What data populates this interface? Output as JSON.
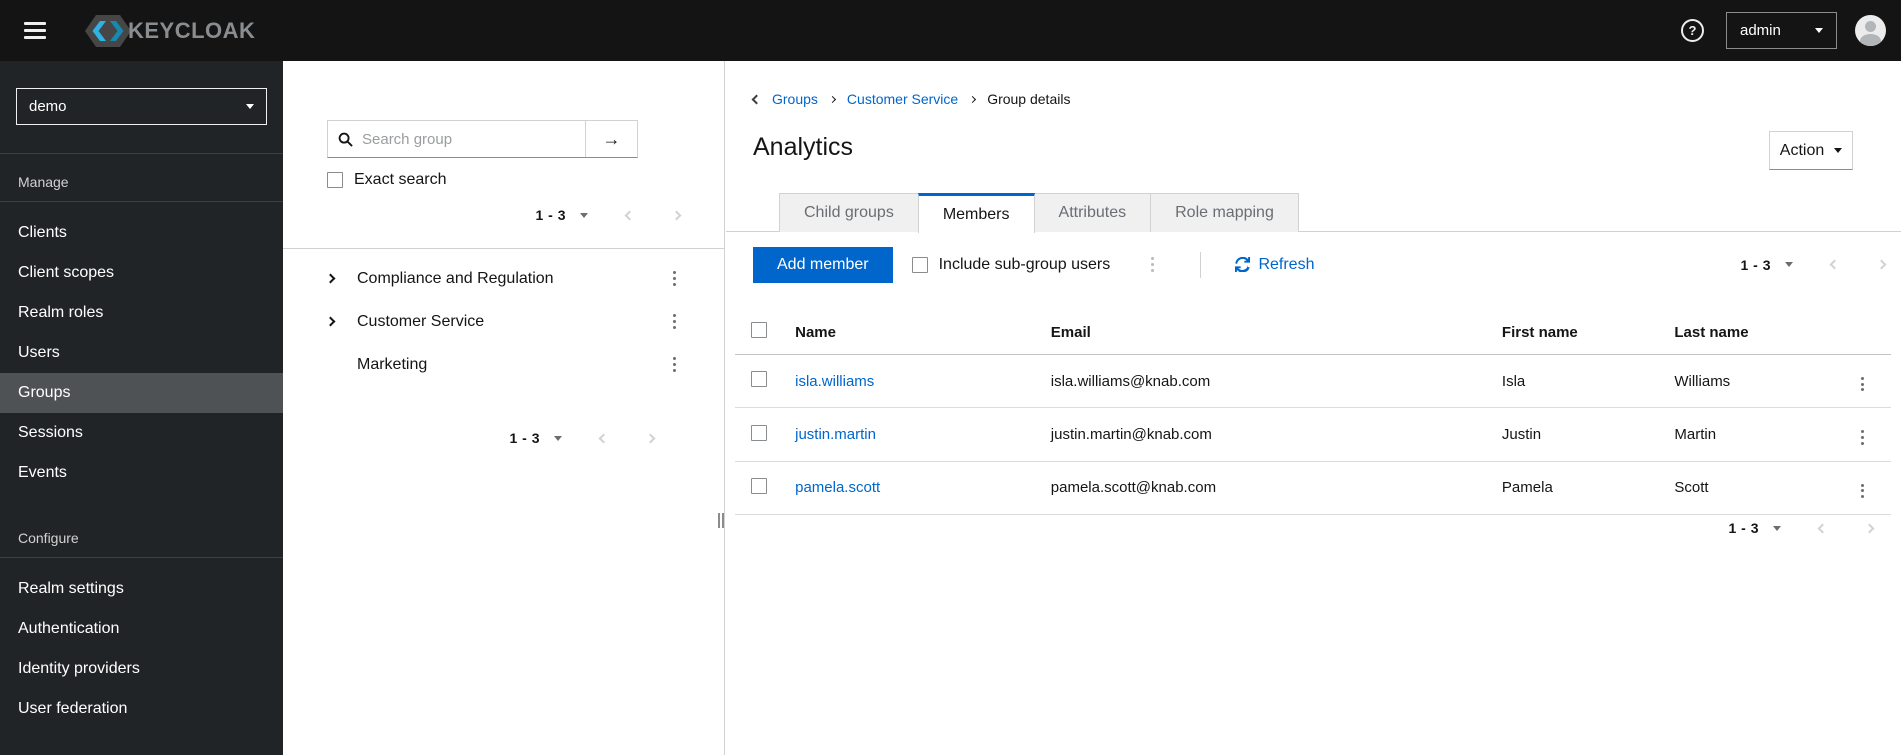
{
  "topbar": {
    "brand": "KEYCLOAK",
    "user": "admin"
  },
  "sidebar": {
    "realm": "demo",
    "sections": [
      {
        "label": "Manage",
        "items": [
          {
            "label": "Clients"
          },
          {
            "label": "Client scopes"
          },
          {
            "label": "Realm roles"
          },
          {
            "label": "Users"
          },
          {
            "label": "Groups",
            "selected": true
          },
          {
            "label": "Sessions"
          },
          {
            "label": "Events"
          }
        ]
      },
      {
        "label": "Configure",
        "items": [
          {
            "label": "Realm settings"
          },
          {
            "label": "Authentication"
          },
          {
            "label": "Identity providers"
          },
          {
            "label": "User federation"
          }
        ]
      }
    ]
  },
  "tree_panel": {
    "search_placeholder": "Search group",
    "exact_search": "Exact search",
    "pagination_top": "1 - 3",
    "pagination_bottom": "1 - 3",
    "groups": [
      {
        "name": "Compliance and Regulation",
        "expandable": true
      },
      {
        "name": "Customer Service",
        "expandable": true
      },
      {
        "name": "Marketing",
        "expandable": false
      }
    ]
  },
  "main": {
    "breadcrumb": {
      "items": [
        "Groups",
        "Customer Service",
        "Group details"
      ]
    },
    "title": "Analytics",
    "action": "Action",
    "active_tab": "Members",
    "tabs": [
      {
        "label": "Child groups"
      },
      {
        "label": "Members"
      },
      {
        "label": "Attributes"
      },
      {
        "label": "Role mapping"
      }
    ],
    "toolbar": {
      "add_member": "Add member",
      "include_subgroups": "Include sub-group users",
      "refresh": "Refresh",
      "pagination": "1 - 3"
    },
    "table": {
      "columns": [
        "Name",
        "Email",
        "First name",
        "Last name"
      ],
      "rows": [
        {
          "name": "isla.williams",
          "email": "isla.williams@knab.com",
          "first": "Isla",
          "last": "Williams"
        },
        {
          "name": "justin.martin",
          "email": "justin.martin@knab.com",
          "first": "Justin",
          "last": "Martin"
        },
        {
          "name": "pamela.scott",
          "email": "pamela.scott@knab.com",
          "first": "Pamela",
          "last": "Scott"
        }
      ],
      "pagination": "1 - 3"
    }
  },
  "colors": {
    "primary": "#0066cc",
    "topbar_bg": "#141414",
    "sidebar_bg": "#212427",
    "sidebar_selected": "#4f5255",
    "muted_text": "#6a6e73",
    "border": "#d2d2d2"
  }
}
